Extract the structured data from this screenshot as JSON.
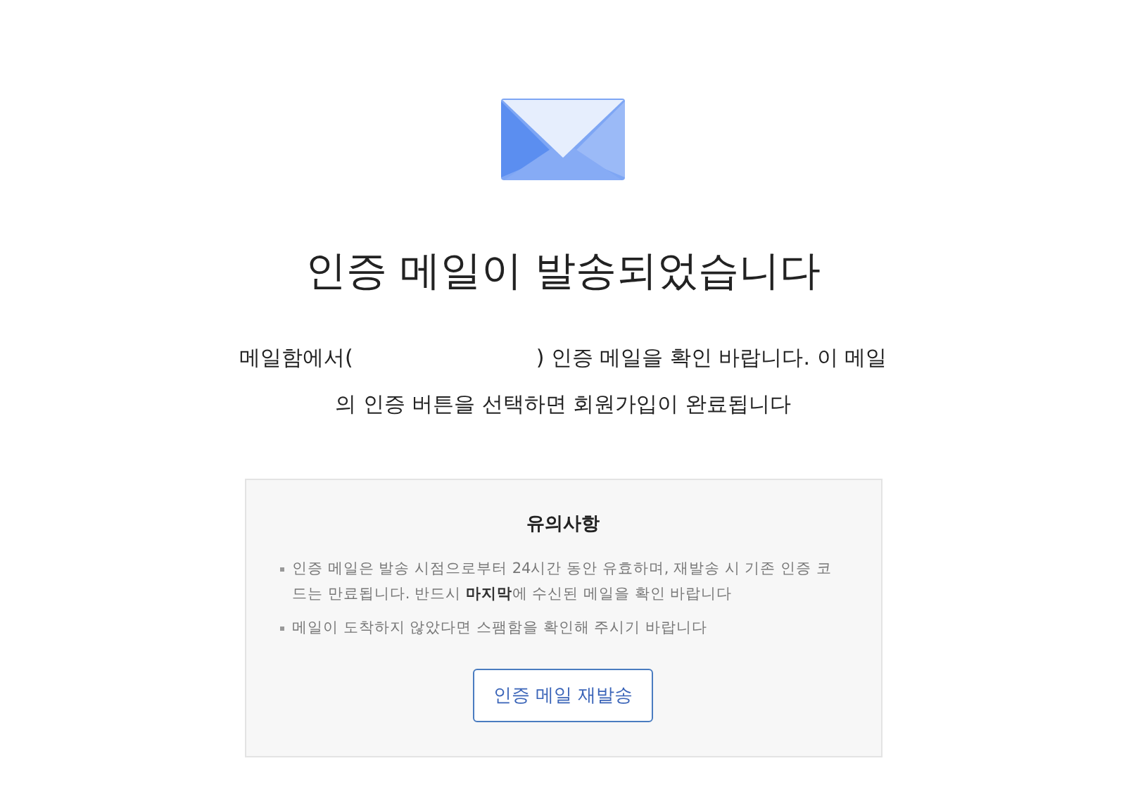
{
  "title": "인증 메일이 발송되었습니다",
  "message": {
    "before": "메일함에서(",
    "after": ") 인증 메일을 확인 바랍니다. 이 메일의 인증 버튼을 선택하면 회원가입이 완료됩니다"
  },
  "notice": {
    "heading": "유의사항",
    "items": [
      "인증 메일은 발송 시점으로부터 24시간 동안 유효하며, 재발송 시 기존 인증 코드는 만료됩니다. 반드시 **마지막**에 수신된 메일을 확인 바랍니다",
      "메일이 도착하지 않았다면 스팸함을 확인해 주시기 바랍니다"
    ],
    "button": "인증 메일 재발송"
  }
}
